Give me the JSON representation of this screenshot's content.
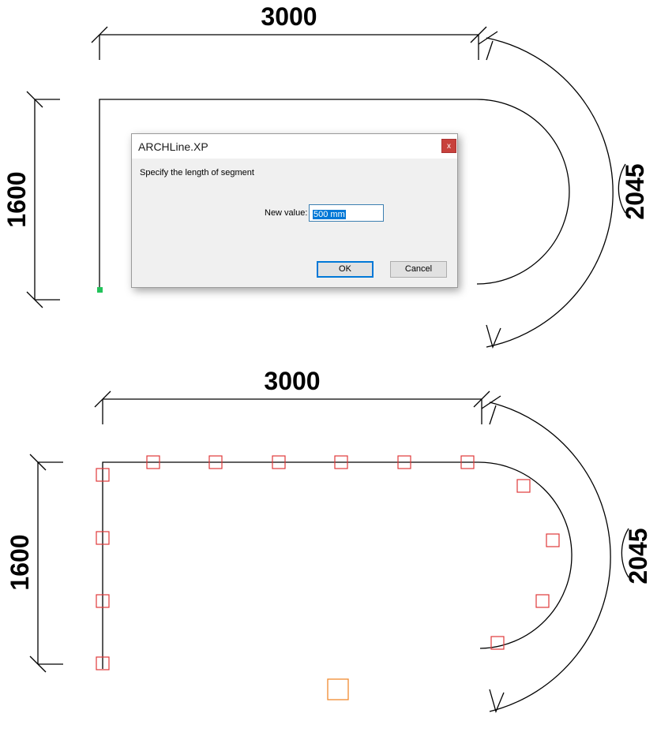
{
  "top_drawing": {
    "dim_width": "3000",
    "dim_height": "1600",
    "dim_arc": "2045"
  },
  "bottom_drawing": {
    "dim_width": "3000",
    "dim_height": "1600",
    "dim_arc": "2045"
  },
  "dialog": {
    "title": "ARCHLine.XP",
    "close_label": "x",
    "prompt": "Specify the length of segment",
    "field_label": "New value:",
    "field_value": "500 mm",
    "ok_label": "OK",
    "cancel_label": "Cancel"
  },
  "colors": {
    "marker": "#e0383a",
    "active_marker": "#f08a30",
    "start_point": "#22c35a"
  }
}
